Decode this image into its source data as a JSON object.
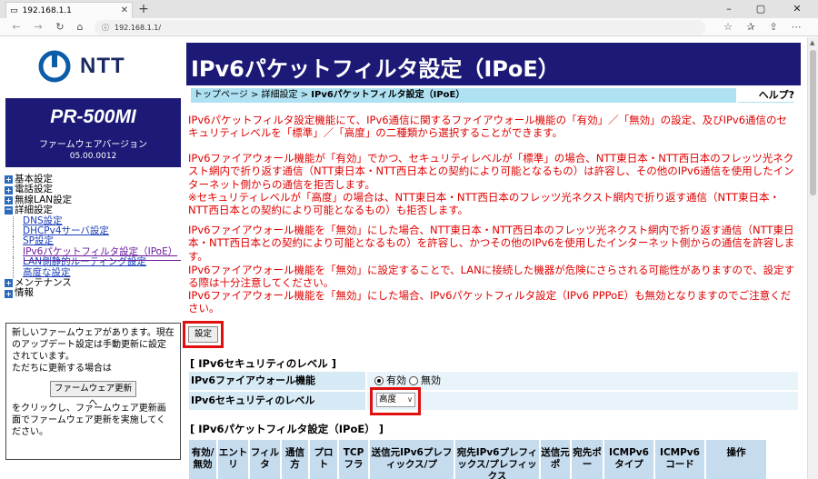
{
  "browser": {
    "tab_title": "192.168.1.1",
    "url": "192.168.1.1/"
  },
  "sidebar": {
    "logo_text": "NTT",
    "model": "PR-500MI",
    "fw_label": "ファームウェアバージョン",
    "fw_version": "05.00.0012",
    "menu": [
      {
        "label": "基本設定",
        "type": "plus"
      },
      {
        "label": "電話設定",
        "type": "plus"
      },
      {
        "label": "無線LAN設定",
        "type": "plus"
      },
      {
        "label": "詳細設定",
        "type": "minus"
      }
    ],
    "submenu": [
      {
        "label": "DNS設定"
      },
      {
        "label": "DHCPv4サーバ設定"
      },
      {
        "label": "SP設定"
      },
      {
        "label": "IPv6パケットフィルタ設定（IPoE）"
      },
      {
        "label": "LAN側静的ルーティング設定"
      },
      {
        "label": "高度な設定"
      }
    ],
    "menu_after": [
      {
        "label": "メンテナンス",
        "type": "plus"
      },
      {
        "label": "情報",
        "type": "plus"
      }
    ],
    "notice": {
      "text1": "新しいファームウェアがあります。現在のアップデート設定は手動更新に設定されています。",
      "text2": "ただちに更新する場合は",
      "button": "ファームウェア更新へ",
      "text3": "をクリックし、ファームウェア更新画面でファームウェア更新を実施してください。"
    }
  },
  "main": {
    "title": "IPv6パケットフィルタ設定（IPoE）",
    "breadcrumb_prefix": "トップページ > 詳細設定 > ",
    "breadcrumb_current": "IPv6パケットフィルタ設定（IPoE）",
    "help": "ヘルプ?",
    "para1": "IPv6パケットフィルタ設定機能にて、IPv6通信に関するファイアウォール機能の「有効」／「無効」の設定、及びIPv6通信のセキュリティレベルを「標準」／「高度」の二種類から選択することができます。",
    "para2": "IPv6ファイアウォール機能が「有効」でかつ、セキュリティレベルが「標準」の場合、NTT東日本・NTT西日本のフレッツ光ネクスト網内で折り返す通信（NTT東日本・NTT西日本との契約により可能となるもの）は許容し、その他のIPv6通信を使用したインターネット側からの通信を拒否します。",
    "para3": "※セキュリティレベルが「高度」の場合は、NTT東日本・NTT西日本のフレッツ光ネクスト網内で折り返す通信（NTT東日本・NTT西日本との契約により可能となるもの）も拒否します。",
    "para4": "IPv6ファイアウォール機能を「無効」にした場合、NTT東日本・NTT西日本のフレッツ光ネクスト網内で折り返す通信（NTT東日本・NTT西日本との契約により可能となるもの）を許容し、かつその他のIPv6を使用したインターネット側からの通信を許容します。",
    "para5": "IPv6ファイアウォール機能を「無効」に設定することで、LANに接続した機器が危険にさらされる可能性がありますので、設定する際は十分注意してください。",
    "para6": "IPv6ファイアウォール機能を「無効」にした場合、IPv6パケットフィルタ設定（IPv6 PPPoE）も無効となりますのでご注意ください。",
    "set_button": "設定",
    "security_section": "[ IPv6セキュリティのレベル ]",
    "firewall_label": "IPv6ファイアウォール機能",
    "opt_enable": "有効",
    "opt_disable": "無効",
    "level_label": "IPv6セキュリティのレベル",
    "level_value": "高度",
    "filter_section": "[ IPv6パケットフィルタ設定（IPoE） ]",
    "table_headers": [
      "有効/無効",
      "エントリ",
      "フィルタ",
      "通信方",
      "プロト",
      "TCPフラ",
      "送信元IPv6プレフィックス/プ",
      "宛先IPv6プレフィックス/プレフィックス",
      "送信元ポ",
      "宛先ポー",
      "ICMPv6タイプ",
      "ICMPv6コード",
      "操作"
    ]
  }
}
